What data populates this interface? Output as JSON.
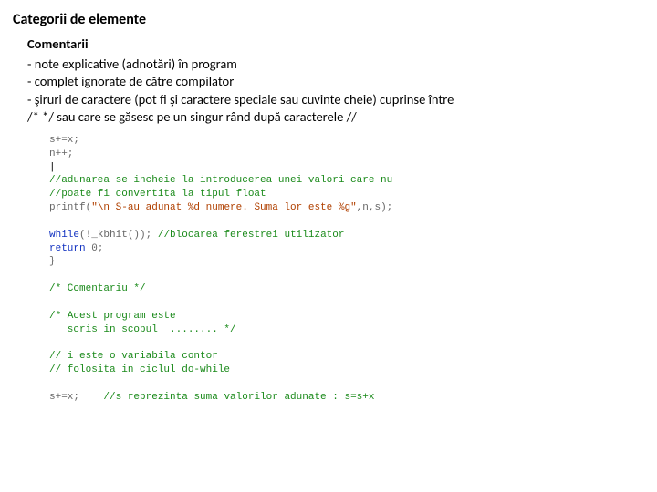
{
  "title": "Categorii de elemente",
  "section": {
    "heading": "Comentarii",
    "lines": [
      "-   note explicative (adnotări) în program",
      "-   complet ignorate de către compilator",
      "-   şiruri de caractere (pot fi şi caractere speciale sau cuvinte cheie) cuprinse între",
      "/*    */ sau care se găsesc pe un singur rând după caracterele  //"
    ]
  },
  "code": {
    "l1a": "s+=x;",
    "l2a": "n++;",
    "l3a": "|",
    "l4a": "//adunarea se incheie la introducerea unei valori care nu",
    "l5a": "//poate fi convertita la tipul float",
    "l6a": "printf(",
    "l6b": "\"\\n S-au adunat %d numere. Suma lor este %g\"",
    "l6c": ",n,s);",
    "blank1": "",
    "l7a": "while",
    "l7b": "(!_kbhit()); ",
    "l7c": "//blocarea ferestrei utilizator",
    "l8a": "return",
    "l8b": " 0;",
    "l9a": "}",
    "blank2": "",
    "c1": "/* Comentariu */",
    "blank3": "",
    "c2": "/* Acest program este",
    "c3": "   scris in scopul  ........ */",
    "blank4": "",
    "c4": "// i este o variabila contor",
    "c5": "// folosita in ciclul do-while",
    "blank5": "",
    "l10a": "s+=x;    ",
    "l10b": "//s reprezinta suma valorilor adunate : s=s+x"
  }
}
